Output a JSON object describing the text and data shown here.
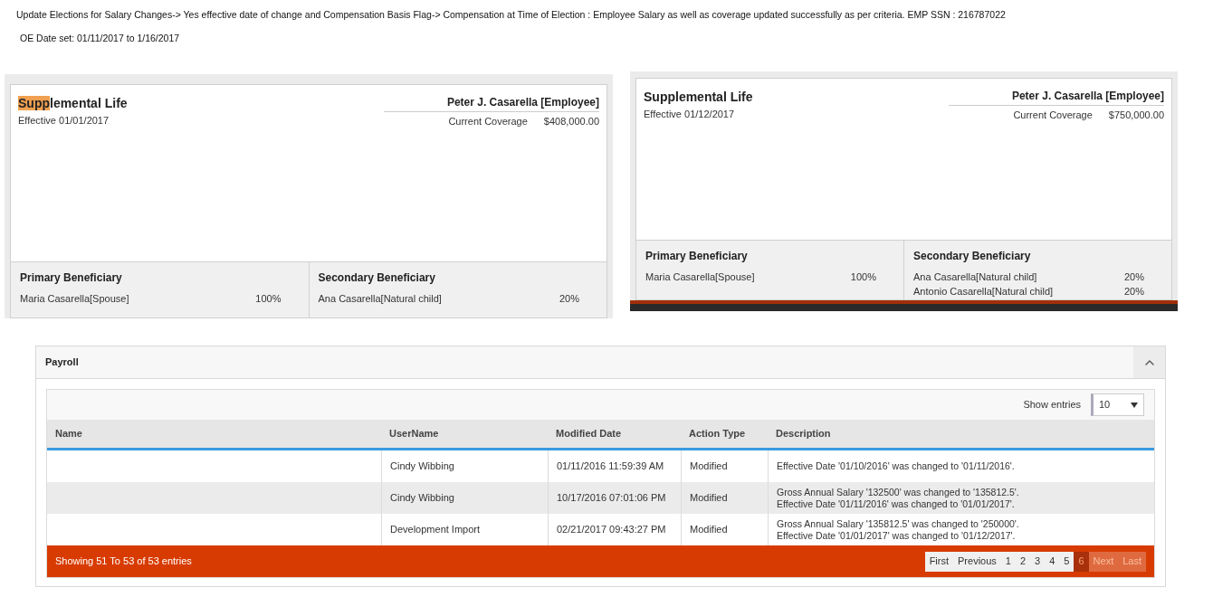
{
  "notes": [
    "Update Elections for Salary Changes-> Yes effective date of change and Compensation Basis Flag-> Compensation at Time of Election : Employee Salary as well as coverage updated successfully as per criteria. EMP SSN : 216787022",
    "OE Date set: 01/11/2017 to 1/16/2017"
  ],
  "cards": [
    {
      "title_highlight": "Supp",
      "title_rest": "lemental Life",
      "effective": "Effective 01/01/2017",
      "person": "Peter J. Casarella [Employee]",
      "coverage_label": "Current Coverage",
      "coverage_value": "$408,000.00",
      "primary_heading": "Primary Beneficiary",
      "primary": [
        {
          "name": "Maria Casarella[Spouse]",
          "share": "100%"
        }
      ],
      "secondary_heading": "Secondary Beneficiary",
      "secondary": [
        {
          "name": "Ana Casarella[Natural child]",
          "share": "20%"
        }
      ],
      "footer_bar": false
    },
    {
      "title_rest": "Supplemental Life",
      "effective": "Effective 01/12/2017",
      "person": "Peter J. Casarella [Employee]",
      "coverage_label": "Current Coverage",
      "coverage_value": "$750,000.00",
      "primary_heading": "Primary Beneficiary",
      "primary": [
        {
          "name": "Maria Casarella[Spouse]",
          "share": "100%"
        }
      ],
      "secondary_heading": "Secondary Beneficiary",
      "secondary": [
        {
          "name": "Ana Casarella[Natural child]",
          "share": "20%"
        },
        {
          "name": "Antonio Casarella[Natural child]",
          "share": "20%"
        }
      ],
      "footer_bar": true
    }
  ],
  "payroll": {
    "title": "Payroll",
    "expanded": true,
    "show_entries_label": "Show entries",
    "page_size": "10",
    "columns": [
      "Name",
      "UserName",
      "Modified Date",
      "Action Type",
      "Description"
    ],
    "rows": [
      {
        "username": "Cindy Wibbing",
        "modified": "01/11/2016 11:59:39 AM",
        "action": "Modified",
        "description": [
          "Effective Date '01/10/2016' was changed to '01/11/2016'."
        ]
      },
      {
        "username": "Cindy Wibbing",
        "modified": "10/17/2016 07:01:06 PM",
        "action": "Modified",
        "description": [
          "Gross Annual Salary '132500' was changed to '135812.5'.",
          "Effective Date '01/11/2016' was changed to '01/01/2017'."
        ]
      },
      {
        "username": "Development Import",
        "modified": "02/21/2017 09:43:27 PM",
        "action": "Modified",
        "description": [
          "Gross Annual Salary '135812.5' was changed to '250000'.",
          "Effective Date '01/01/2017' was changed to '01/12/2017'."
        ]
      }
    ],
    "summary": "Showing 51 To 53 of 53 entries",
    "pages": [
      {
        "label": "First",
        "selected": false,
        "disabled": false
      },
      {
        "label": "Previous",
        "selected": false,
        "disabled": false
      },
      {
        "label": "1",
        "selected": false,
        "disabled": false
      },
      {
        "label": "2",
        "selected": false,
        "disabled": false
      },
      {
        "label": "3",
        "selected": false,
        "disabled": false
      },
      {
        "label": "4",
        "selected": false,
        "disabled": false
      },
      {
        "label": "5",
        "selected": false,
        "disabled": false
      },
      {
        "label": "6",
        "selected": true,
        "disabled": false
      },
      {
        "label": "Next",
        "selected": false,
        "disabled": true
      },
      {
        "label": "Last",
        "selected": false,
        "disabled": true
      }
    ]
  }
}
